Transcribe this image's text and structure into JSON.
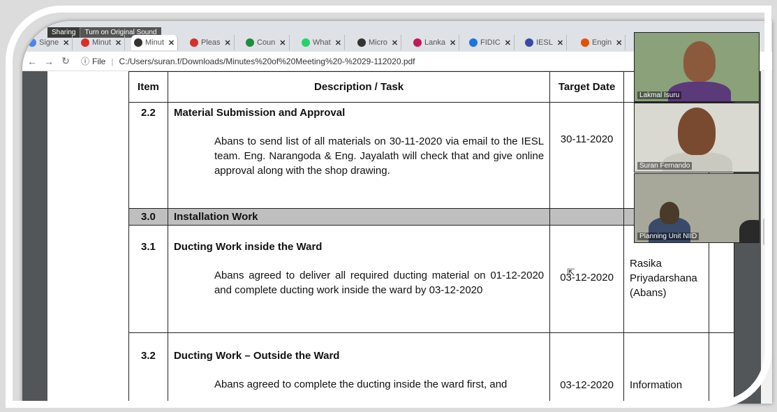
{
  "browser": {
    "sharing_text": "Sharing",
    "sound_button": "Turn on Original Sound",
    "tabs": [
      {
        "label": "Signe",
        "icon": "edit-icon",
        "color": "#4285f4",
        "active": false
      },
      {
        "label": "Minut",
        "icon": "gmail-icon",
        "color": "#d93025",
        "active": false
      },
      {
        "label": "Minut",
        "icon": "browser-icon",
        "color": "#333333",
        "active": true
      },
      {
        "label": "Pleas",
        "icon": "app-icon",
        "color": "#d93025",
        "active": false
      },
      {
        "label": "Coun",
        "icon": "cloud-icon",
        "color": "#1e8e3e",
        "active": false
      },
      {
        "label": "What",
        "icon": "whatsapp-icon",
        "color": "#25d366",
        "active": false
      },
      {
        "label": "Micro",
        "icon": "browser-icon",
        "color": "#333333",
        "active": false
      },
      {
        "label": "Lanka",
        "icon": "swirl-icon",
        "color": "#c2185b",
        "active": false
      },
      {
        "label": "FIDIC",
        "icon": "dash-icon",
        "color": "#1a73e8",
        "active": false
      },
      {
        "label": "IESL",
        "icon": "square-icon",
        "color": "#3949ab",
        "active": false
      },
      {
        "label": "Engin",
        "icon": "triangle-icon",
        "color": "#e65100",
        "active": false
      }
    ],
    "file_label": "File",
    "url": "C:/Users/suran.f/Downloads/Minutes%20of%20Meeting%20-%2029-112020.pdf"
  },
  "table": {
    "headers": {
      "item": "Item",
      "description": "Description / Task",
      "target_date": "Target Date"
    },
    "rows": [
      {
        "item": "2.2",
        "title": "Material Submission and Approval",
        "text": "Abans to send list of all materials on 30-11-2020 via email to the IESL team. Eng. Narangoda & Eng. Jayalath will check that and give online approval along with the shop drawing.",
        "date": "30-11-2020",
        "responsible": ""
      },
      {
        "item": "3.0",
        "title": "Installation Work",
        "section": true
      },
      {
        "item": "3.1",
        "title": "Ducting Work inside the Ward",
        "text": "Abans agreed to deliver all required ducting material on 01-12-2020 and complete ducting work inside the ward by 03-12-2020",
        "date": "03-12-2020",
        "responsible": "Rasika Priyadarshana (Abans)"
      },
      {
        "item": "3.2",
        "title": "Ducting Work – Outside the Ward",
        "text": "Abans agreed to complete the ducting inside the ward first, and",
        "date": "03-12-2020",
        "responsible": "Information"
      }
    ]
  },
  "participants": [
    {
      "name": "Lakmal Isuru"
    },
    {
      "name": "Suran Fernando"
    },
    {
      "name": "Planning Unit NIID"
    }
  ]
}
